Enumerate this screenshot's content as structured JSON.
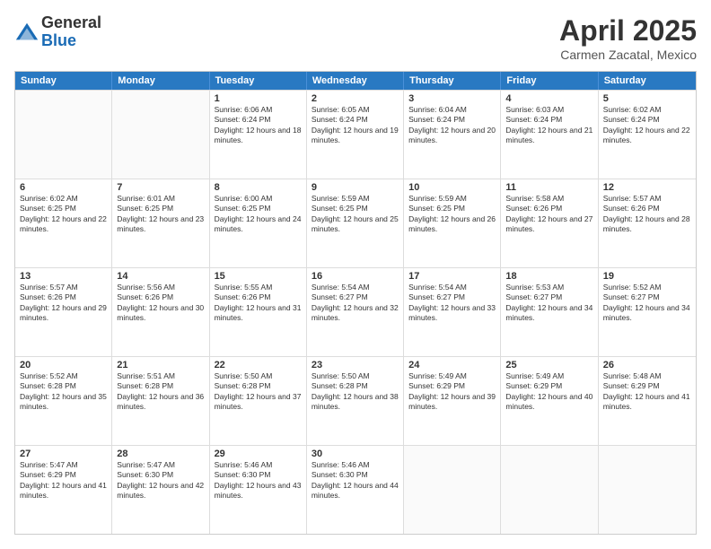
{
  "logo": {
    "general": "General",
    "blue": "Blue"
  },
  "header": {
    "title": "April 2025",
    "subtitle": "Carmen Zacatal, Mexico"
  },
  "weekdays": [
    "Sunday",
    "Monday",
    "Tuesday",
    "Wednesday",
    "Thursday",
    "Friday",
    "Saturday"
  ],
  "weeks": [
    [
      {
        "day": "",
        "empty": true
      },
      {
        "day": "",
        "empty": true
      },
      {
        "day": "1",
        "sunrise": "Sunrise: 6:06 AM",
        "sunset": "Sunset: 6:24 PM",
        "daylight": "Daylight: 12 hours and 18 minutes."
      },
      {
        "day": "2",
        "sunrise": "Sunrise: 6:05 AM",
        "sunset": "Sunset: 6:24 PM",
        "daylight": "Daylight: 12 hours and 19 minutes."
      },
      {
        "day": "3",
        "sunrise": "Sunrise: 6:04 AM",
        "sunset": "Sunset: 6:24 PM",
        "daylight": "Daylight: 12 hours and 20 minutes."
      },
      {
        "day": "4",
        "sunrise": "Sunrise: 6:03 AM",
        "sunset": "Sunset: 6:24 PM",
        "daylight": "Daylight: 12 hours and 21 minutes."
      },
      {
        "day": "5",
        "sunrise": "Sunrise: 6:02 AM",
        "sunset": "Sunset: 6:24 PM",
        "daylight": "Daylight: 12 hours and 22 minutes."
      }
    ],
    [
      {
        "day": "6",
        "sunrise": "Sunrise: 6:02 AM",
        "sunset": "Sunset: 6:25 PM",
        "daylight": "Daylight: 12 hours and 22 minutes."
      },
      {
        "day": "7",
        "sunrise": "Sunrise: 6:01 AM",
        "sunset": "Sunset: 6:25 PM",
        "daylight": "Daylight: 12 hours and 23 minutes."
      },
      {
        "day": "8",
        "sunrise": "Sunrise: 6:00 AM",
        "sunset": "Sunset: 6:25 PM",
        "daylight": "Daylight: 12 hours and 24 minutes."
      },
      {
        "day": "9",
        "sunrise": "Sunrise: 5:59 AM",
        "sunset": "Sunset: 6:25 PM",
        "daylight": "Daylight: 12 hours and 25 minutes."
      },
      {
        "day": "10",
        "sunrise": "Sunrise: 5:59 AM",
        "sunset": "Sunset: 6:25 PM",
        "daylight": "Daylight: 12 hours and 26 minutes."
      },
      {
        "day": "11",
        "sunrise": "Sunrise: 5:58 AM",
        "sunset": "Sunset: 6:26 PM",
        "daylight": "Daylight: 12 hours and 27 minutes."
      },
      {
        "day": "12",
        "sunrise": "Sunrise: 5:57 AM",
        "sunset": "Sunset: 6:26 PM",
        "daylight": "Daylight: 12 hours and 28 minutes."
      }
    ],
    [
      {
        "day": "13",
        "sunrise": "Sunrise: 5:57 AM",
        "sunset": "Sunset: 6:26 PM",
        "daylight": "Daylight: 12 hours and 29 minutes."
      },
      {
        "day": "14",
        "sunrise": "Sunrise: 5:56 AM",
        "sunset": "Sunset: 6:26 PM",
        "daylight": "Daylight: 12 hours and 30 minutes."
      },
      {
        "day": "15",
        "sunrise": "Sunrise: 5:55 AM",
        "sunset": "Sunset: 6:26 PM",
        "daylight": "Daylight: 12 hours and 31 minutes."
      },
      {
        "day": "16",
        "sunrise": "Sunrise: 5:54 AM",
        "sunset": "Sunset: 6:27 PM",
        "daylight": "Daylight: 12 hours and 32 minutes."
      },
      {
        "day": "17",
        "sunrise": "Sunrise: 5:54 AM",
        "sunset": "Sunset: 6:27 PM",
        "daylight": "Daylight: 12 hours and 33 minutes."
      },
      {
        "day": "18",
        "sunrise": "Sunrise: 5:53 AM",
        "sunset": "Sunset: 6:27 PM",
        "daylight": "Daylight: 12 hours and 34 minutes."
      },
      {
        "day": "19",
        "sunrise": "Sunrise: 5:52 AM",
        "sunset": "Sunset: 6:27 PM",
        "daylight": "Daylight: 12 hours and 34 minutes."
      }
    ],
    [
      {
        "day": "20",
        "sunrise": "Sunrise: 5:52 AM",
        "sunset": "Sunset: 6:28 PM",
        "daylight": "Daylight: 12 hours and 35 minutes."
      },
      {
        "day": "21",
        "sunrise": "Sunrise: 5:51 AM",
        "sunset": "Sunset: 6:28 PM",
        "daylight": "Daylight: 12 hours and 36 minutes."
      },
      {
        "day": "22",
        "sunrise": "Sunrise: 5:50 AM",
        "sunset": "Sunset: 6:28 PM",
        "daylight": "Daylight: 12 hours and 37 minutes."
      },
      {
        "day": "23",
        "sunrise": "Sunrise: 5:50 AM",
        "sunset": "Sunset: 6:28 PM",
        "daylight": "Daylight: 12 hours and 38 minutes."
      },
      {
        "day": "24",
        "sunrise": "Sunrise: 5:49 AM",
        "sunset": "Sunset: 6:29 PM",
        "daylight": "Daylight: 12 hours and 39 minutes."
      },
      {
        "day": "25",
        "sunrise": "Sunrise: 5:49 AM",
        "sunset": "Sunset: 6:29 PM",
        "daylight": "Daylight: 12 hours and 40 minutes."
      },
      {
        "day": "26",
        "sunrise": "Sunrise: 5:48 AM",
        "sunset": "Sunset: 6:29 PM",
        "daylight": "Daylight: 12 hours and 41 minutes."
      }
    ],
    [
      {
        "day": "27",
        "sunrise": "Sunrise: 5:47 AM",
        "sunset": "Sunset: 6:29 PM",
        "daylight": "Daylight: 12 hours and 41 minutes."
      },
      {
        "day": "28",
        "sunrise": "Sunrise: 5:47 AM",
        "sunset": "Sunset: 6:30 PM",
        "daylight": "Daylight: 12 hours and 42 minutes."
      },
      {
        "day": "29",
        "sunrise": "Sunrise: 5:46 AM",
        "sunset": "Sunset: 6:30 PM",
        "daylight": "Daylight: 12 hours and 43 minutes."
      },
      {
        "day": "30",
        "sunrise": "Sunrise: 5:46 AM",
        "sunset": "Sunset: 6:30 PM",
        "daylight": "Daylight: 12 hours and 44 minutes."
      },
      {
        "day": "",
        "empty": true
      },
      {
        "day": "",
        "empty": true
      },
      {
        "day": "",
        "empty": true
      }
    ]
  ]
}
